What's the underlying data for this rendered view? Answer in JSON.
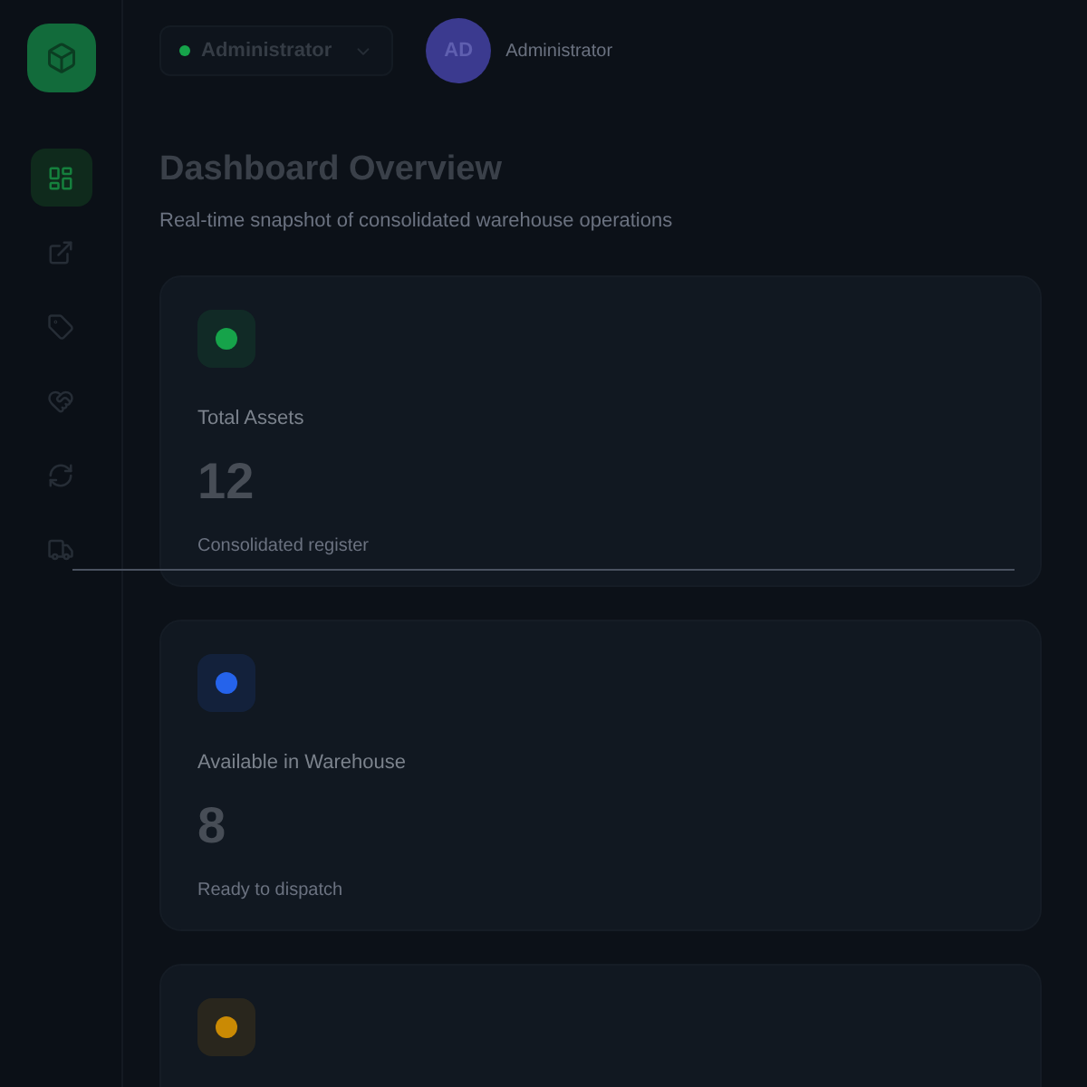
{
  "sidebar": {
    "items": [
      {
        "kind": "dashboard",
        "selected": true
      },
      {
        "kind": "export",
        "selected": false
      },
      {
        "kind": "tag",
        "selected": false
      },
      {
        "kind": "handshake",
        "selected": false
      },
      {
        "kind": "refresh",
        "selected": false
      },
      {
        "kind": "truck",
        "selected": false
      }
    ]
  },
  "header": {
    "role": {
      "label": "Administrator",
      "color": "#16a34a"
    },
    "user": {
      "initials": "AD",
      "name": "Administrator"
    }
  },
  "page": {
    "title": "Dashboard Overview",
    "subtitle": "Real-time snapshot of consolidated warehouse operations"
  },
  "cards": [
    {
      "color": "#16a34a",
      "label": "Total Assets",
      "value": "12",
      "note": "Consolidated register"
    },
    {
      "color": "#2563eb",
      "label": "Available in Warehouse",
      "value": "8",
      "note": "Ready to dispatch"
    },
    {
      "color": "#ca8a04"
    }
  ]
}
